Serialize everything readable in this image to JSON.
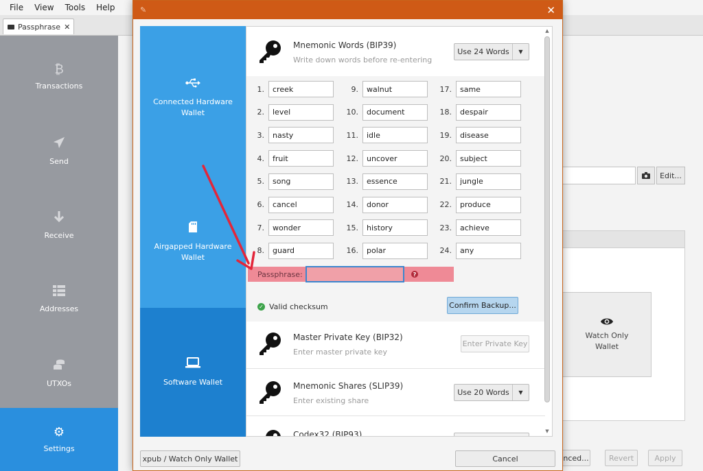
{
  "menu": [
    "File",
    "View",
    "Tools",
    "Help"
  ],
  "tab": {
    "label": "Passphrase",
    "close": "✕"
  },
  "nav": [
    {
      "label": "Transactions",
      "icon": "bitcoin-icon"
    },
    {
      "label": "Send",
      "icon": "send-icon"
    },
    {
      "label": "Receive",
      "icon": "receive-icon"
    },
    {
      "label": "Addresses",
      "icon": "addresses-icon"
    },
    {
      "label": "UTXOs",
      "icon": "coins-icon"
    },
    {
      "label": "Settings",
      "icon": "gear-icon"
    }
  ],
  "background": {
    "edit_label": "Edit...",
    "watch_only_label": "Watch Only Wallet",
    "advanced_label": "nced...",
    "revert_label": "Revert",
    "apply_label": "Apply"
  },
  "dialog": {
    "close": "✕",
    "options": [
      {
        "label": "Connected Hardware Wallet",
        "icon": "usb-icon"
      },
      {
        "label": "Airgapped Hardware Wallet",
        "icon": "sdcard-icon"
      },
      {
        "label": "Software Wallet",
        "icon": "laptop-icon"
      }
    ],
    "mnemonic": {
      "title": "Mnemonic Words (BIP39)",
      "subtitle": "Write down words before re-entering",
      "select": "Use 24 Words",
      "words": [
        "creek",
        "level",
        "nasty",
        "fruit",
        "song",
        "cancel",
        "wonder",
        "guard",
        "walnut",
        "document",
        "idle",
        "uncover",
        "essence",
        "donor",
        "history",
        "polar",
        "same",
        "despair",
        "disease",
        "subject",
        "jungle",
        "produce",
        "achieve",
        "any"
      ],
      "passphrase_label": "Passphrase:",
      "passphrase_value": "",
      "checksum": "Valid checksum",
      "confirm": "Confirm Backup..."
    },
    "master_key": {
      "title": "Master Private Key (BIP32)",
      "subtitle": "Enter master private key",
      "button": "Enter Private Key"
    },
    "shares": {
      "title": "Mnemonic Shares (SLIP39)",
      "subtitle": "Enter existing share",
      "select": "Use 20 Words"
    },
    "codex": {
      "title": "Codex32 (BIP93)"
    },
    "xpub_button": "xpub / Watch Only Wallet",
    "cancel_button": "Cancel"
  },
  "colors": {
    "accent": "#2a8fde",
    "title_bar": "#cf5a16",
    "error": "#ef8a96",
    "annotation": "#e3263a"
  }
}
